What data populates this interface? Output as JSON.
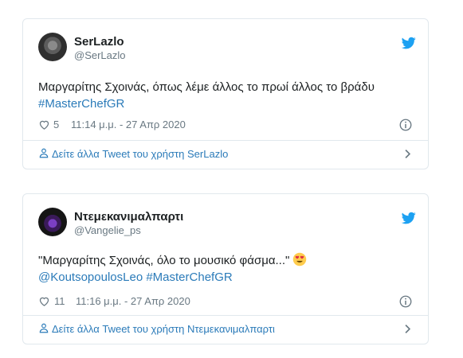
{
  "tweets": [
    {
      "user_name": "SerLazlo",
      "handle": "@SerLazlo",
      "text_line1": "Μαργαρίτης Σχοινάς, όπως λέμε άλλος το πρωί άλλος το βράδυ",
      "hashtag": "#MasterChefGR",
      "likes": "5",
      "timestamp": "11:14 μ.μ. - 27 Απρ 2020",
      "more_link": "Δείτε άλλα Tweet του χρήστη SerLazlo"
    },
    {
      "user_name": "Ντεμεκανιμαλπαρτι",
      "handle": "@Vangelie_ps",
      "text_line1": "\"Μαργαρίτης Σχοινάς, όλο το μουσικό φάσμα...\"",
      "mention": "@KoutsopoulosLeo",
      "hashtag": "#MasterChefGR",
      "likes": "11",
      "timestamp": "11:16 μ.μ. - 27 Απρ 2020",
      "more_link": "Δείτε άλλα Tweet του χρήστη Ντεμεκανιμαλπαρτι"
    }
  ],
  "icons": {
    "twitter_bird": "twitter-bird-icon",
    "heart": "heart-icon",
    "info": "info-icon",
    "person": "person-icon",
    "chevron": "chevron-right-icon",
    "emoji": "heart-eyes-emoji"
  },
  "colors": {
    "link": "#2b7bb9",
    "bird": "#1da1f2",
    "muted": "#697882",
    "border": "#e1e8ed"
  }
}
